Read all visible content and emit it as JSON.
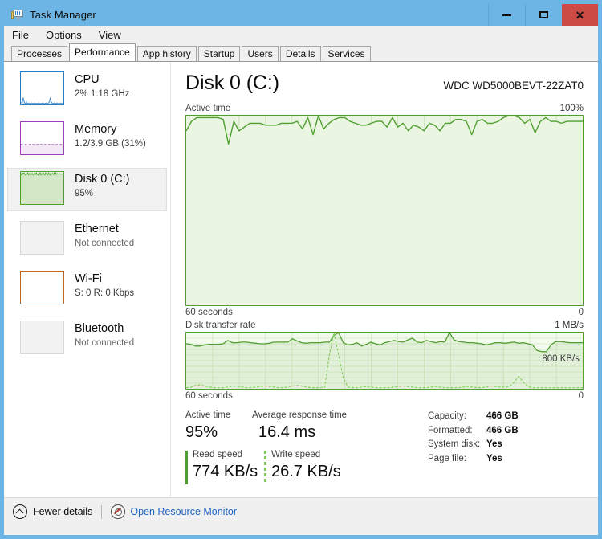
{
  "window": {
    "title": "Task Manager",
    "icon": "task-manager-icon",
    "buttons": {
      "minimize": "–",
      "maximize": "□",
      "close": "✕"
    },
    "titlebar_color": "#6cb5e5",
    "close_color": "#cc4b44"
  },
  "menu": {
    "items": [
      "File",
      "Options",
      "View"
    ]
  },
  "tabs": [
    {
      "label": "Processes",
      "active": false
    },
    {
      "label": "Performance",
      "active": true
    },
    {
      "label": "App history",
      "active": false
    },
    {
      "label": "Startup",
      "active": false
    },
    {
      "label": "Users",
      "active": false
    },
    {
      "label": "Details",
      "active": false
    },
    {
      "label": "Services",
      "active": false
    }
  ],
  "sidebar": {
    "items": [
      {
        "name": "cpu",
        "title": "CPU",
        "sub": "2% 1.18 GHz",
        "sub_bold": null,
        "selected": false,
        "accent": "#2a7cc1",
        "fill": "#ffffff",
        "graph": "cpu"
      },
      {
        "name": "memory",
        "title": "Memory",
        "sub": "1.2/3.9 GB (31%)",
        "sub_bold": null,
        "selected": false,
        "accent": "#9b3fb5",
        "fill": "#ffffff",
        "graph": "memory"
      },
      {
        "name": "disk-0-c",
        "title": "Disk 0 (C:)",
        "sub": "95%",
        "sub_bold": null,
        "selected": true,
        "accent": "#4f9f30",
        "fill": "#eaf5e2",
        "graph": "disk"
      },
      {
        "name": "ethernet",
        "title": "Ethernet",
        "sub": "Not connected",
        "sub_bold": null,
        "selected": false,
        "accent": "#cccccc",
        "fill": "#f2f2f2",
        "graph": "empty"
      },
      {
        "name": "wifi",
        "title": "Wi-Fi",
        "sub": "S: 0 R: 0 Kbps",
        "sub_bold": [
          "0",
          "0 Kbps"
        ],
        "selected": false,
        "accent": "#c06a22",
        "fill": "#ffffff",
        "graph": "empty"
      },
      {
        "name": "bluetooth",
        "title": "Bluetooth",
        "sub": "Not connected",
        "sub_bold": null,
        "selected": false,
        "accent": "#cccccc",
        "fill": "#f2f2f2",
        "graph": "empty"
      }
    ]
  },
  "main": {
    "title": "Disk 0 (C:)",
    "model": "WDC WD5000BEVT-22ZAT0",
    "active_graph": {
      "caption": "Active time",
      "max_label": "100%",
      "time_label": "60 seconds",
      "min_label": "0"
    },
    "rate_graph": {
      "caption": "Disk transfer rate",
      "max_label": "1 MB/s",
      "overlay_label": "800 KB/s",
      "time_label": "60 seconds",
      "min_label": "0"
    },
    "stats": {
      "active_time_label": "Active time",
      "active_time_value": "95%",
      "avg_response_label": "Average response time",
      "avg_response_value": "16.4 ms",
      "read_speed_label": "Read speed",
      "read_speed_value": "774 KB/s",
      "write_speed_label": "Write speed",
      "write_speed_value": "26.7 KB/s",
      "info": [
        {
          "key": "Capacity:",
          "value": "466 GB"
        },
        {
          "key": "Formatted:",
          "value": "466 GB"
        },
        {
          "key": "System disk:",
          "value": "Yes"
        },
        {
          "key": "Page file:",
          "value": "Yes"
        }
      ]
    }
  },
  "statusbar": {
    "fewer_details": "Fewer details",
    "fewer_icon": "chevron-up-circle-icon",
    "resource_monitor": "Open Resource Monitor",
    "resource_icon": "resource-monitor-icon"
  },
  "chart_data": [
    {
      "type": "area",
      "name": "active-time",
      "title": "Active time",
      "ylabel": "",
      "ylim": [
        0,
        100
      ],
      "xlabel": "60 seconds",
      "grid": true,
      "grid_cols": 15,
      "grid_rows": 10,
      "line_color": "#4f9f30",
      "fill_color": "#eaf5e2",
      "series": [
        {
          "name": "Active time %",
          "values": [
            92,
            97,
            99,
            99,
            99,
            99,
            99,
            98,
            85,
            97,
            92,
            94,
            96,
            96,
            96,
            95,
            95,
            95,
            96,
            96,
            96,
            97,
            93,
            99,
            90,
            100,
            93,
            96,
            98,
            99,
            99,
            97,
            96,
            95,
            95,
            96,
            97,
            97,
            94,
            99,
            94,
            96,
            92,
            95,
            94,
            92,
            96,
            95,
            92,
            96,
            96,
            98,
            98,
            97,
            90,
            97,
            98,
            96,
            96,
            97,
            99,
            100,
            100,
            99,
            96,
            98,
            91,
            97,
            99,
            97,
            97,
            96,
            97,
            97,
            97
          ]
        }
      ]
    },
    {
      "type": "line",
      "name": "disk-transfer-rate",
      "title": "Disk transfer rate",
      "ylim_label_max": "1 MB/s",
      "ylim_label_min": "0",
      "overlay_gridline_label": "800 KB/s",
      "xlabel": "60 seconds",
      "grid": true,
      "grid_cols": 15,
      "line_color_read": "#4f9f30",
      "line_color_write": "#8fd06a",
      "series": [
        {
          "name": "Read speed",
          "style": "solid",
          "values": [
            80,
            79,
            76,
            76,
            78,
            79,
            79,
            79,
            80,
            86,
            82,
            82,
            83,
            83,
            82,
            81,
            80,
            80,
            81,
            83,
            83,
            83,
            83,
            89,
            85,
            82,
            81,
            82,
            82,
            82,
            83,
            83,
            95,
            100,
            82,
            78,
            79,
            82,
            76,
            79,
            83,
            80,
            78,
            82,
            84,
            86,
            84,
            83,
            87,
            90,
            83,
            82,
            86,
            84,
            82,
            84,
            83,
            100,
            87,
            84,
            83,
            82,
            82,
            81,
            80,
            78,
            80,
            82,
            82,
            81,
            82,
            83,
            81,
            82,
            82,
            80,
            78,
            68,
            66,
            66,
            78,
            84,
            84,
            83,
            82,
            82,
            82
          ]
        },
        {
          "name": "Write speed",
          "style": "dashed",
          "values": [
            2,
            3,
            6,
            7,
            5,
            3,
            2,
            2,
            2,
            3,
            5,
            4,
            3,
            2,
            2,
            3,
            4,
            5,
            4,
            3,
            2,
            2,
            3,
            5,
            6,
            5,
            3,
            2,
            2,
            2,
            3,
            60,
            100,
            60,
            20,
            3,
            2,
            2,
            3,
            4,
            3,
            2,
            2,
            2,
            2,
            3,
            4,
            5,
            4,
            3,
            2,
            2,
            2,
            3,
            4,
            3,
            2,
            2,
            2,
            2,
            3,
            4,
            3,
            2,
            2,
            3,
            5,
            4,
            3,
            3,
            4,
            12,
            22,
            12,
            4,
            2,
            2
          ]
        }
      ]
    },
    {
      "type": "line",
      "name": "cpu-thumbnail",
      "title": "CPU",
      "line_color": "#2a7cc1",
      "values": [
        3,
        5,
        12,
        4,
        3,
        8,
        3,
        2,
        2,
        3,
        2,
        2,
        3,
        2,
        2,
        2,
        3,
        2,
        2,
        3,
        2,
        2,
        2,
        3,
        2,
        2,
        2,
        2,
        3,
        2,
        2,
        2,
        3,
        2,
        2,
        2,
        2,
        3,
        2,
        2,
        10,
        4,
        2,
        3,
        2,
        2,
        3,
        2,
        2,
        2
      ]
    },
    {
      "type": "area",
      "name": "memory-thumbnail",
      "title": "Memory",
      "line_color": "#9b3fb5",
      "values": [
        31,
        31,
        31,
        31,
        31,
        32,
        31,
        31,
        31,
        31,
        31,
        31,
        32,
        31,
        31,
        31,
        31,
        31,
        31,
        31,
        31,
        32,
        31,
        31,
        31,
        31,
        31,
        31,
        31,
        31,
        31,
        31,
        31,
        31,
        31,
        31,
        31,
        31,
        31,
        31,
        31,
        31,
        31,
        31,
        31,
        31,
        31,
        31,
        31,
        31
      ]
    },
    {
      "type": "area",
      "name": "disk-thumbnail",
      "title": "Disk 0 (C:)",
      "line_color": "#4f9f30",
      "values": [
        92,
        97,
        99,
        95,
        99,
        92,
        97,
        95,
        99,
        94,
        97,
        96,
        93,
        99,
        95,
        97,
        92,
        98,
        95,
        99,
        96,
        94,
        97,
        95,
        99,
        93,
        97,
        96,
        98,
        94,
        96,
        99,
        95,
        97,
        93,
        98,
        96,
        94,
        99,
        95,
        97,
        96,
        98,
        95,
        99,
        94,
        97,
        96,
        97,
        96
      ]
    }
  ]
}
